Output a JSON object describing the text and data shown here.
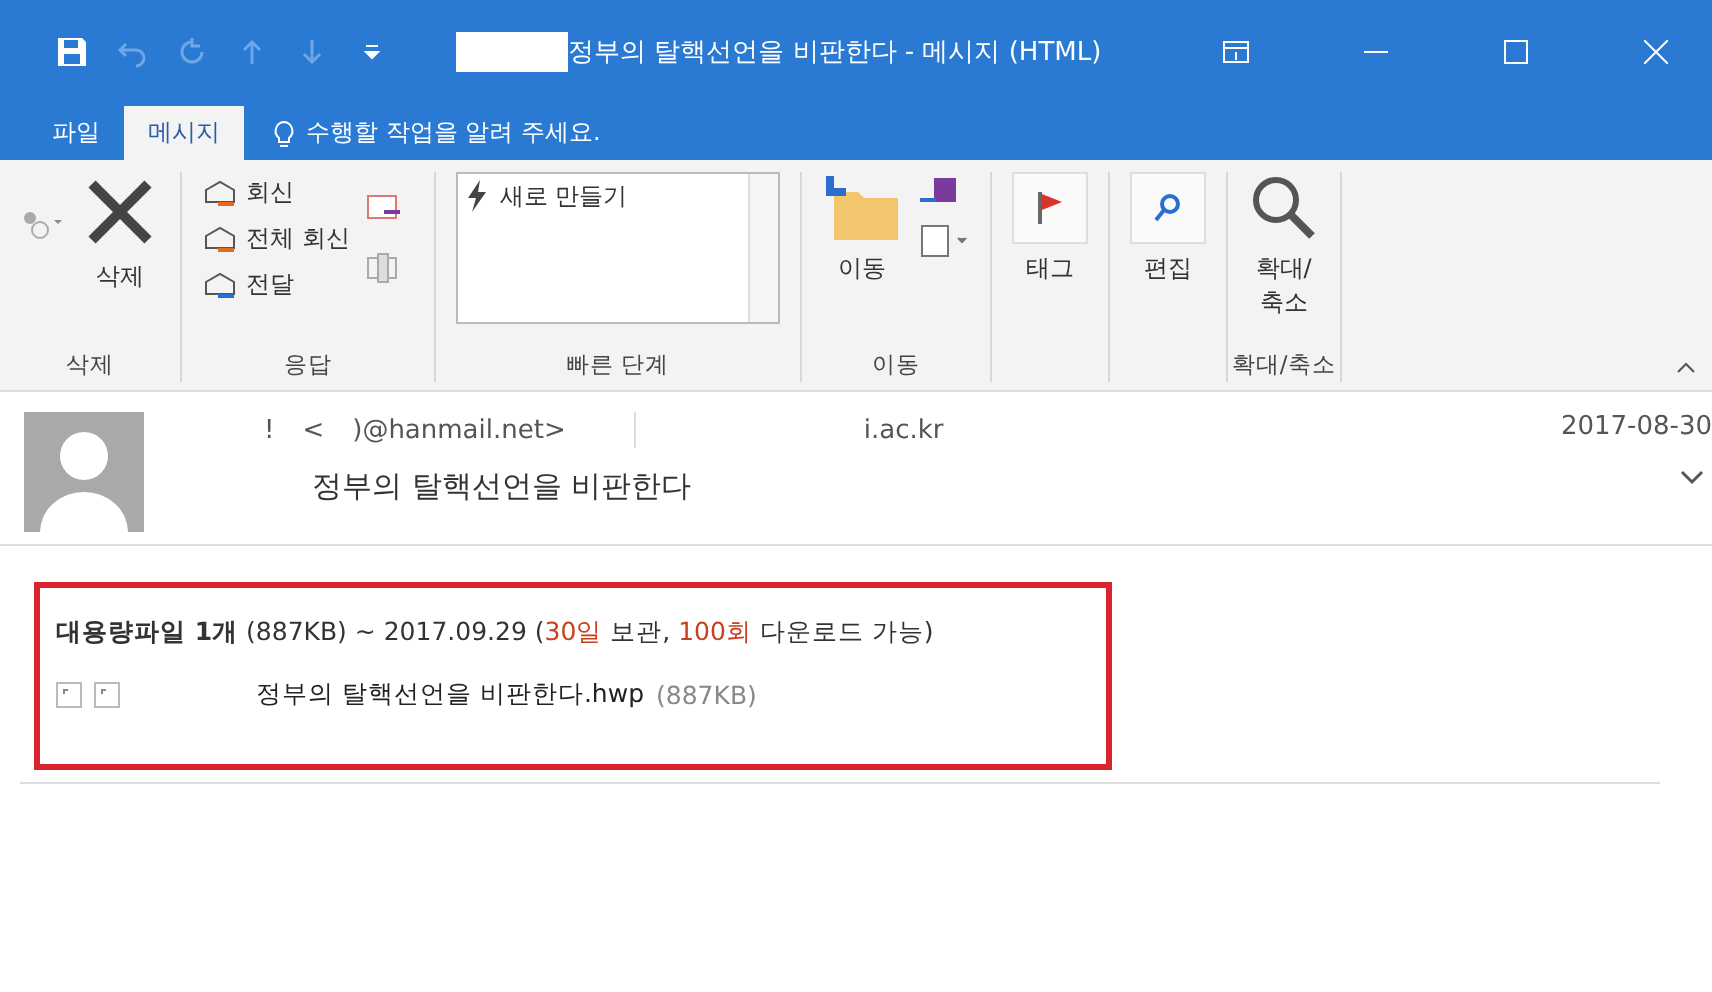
{
  "window": {
    "title": "정부의 탈핵선언을 비판한다 - 메시지 (HTML)"
  },
  "tabs": [
    {
      "label": "파일",
      "selected": false
    },
    {
      "label": "메시지",
      "selected": true
    }
  ],
  "tell_me": {
    "placeholder": "수행할 작업을 알려 주세요."
  },
  "ribbon": {
    "groups": [
      {
        "label": "삭제",
        "buttons": [
          {
            "kind": "ignore"
          },
          {
            "kind": "delete",
            "label": "삭제"
          }
        ]
      },
      {
        "label": "응답",
        "buttons": [
          {
            "kind": "reply",
            "label": "회신"
          },
          {
            "kind": "reply_all",
            "label": "전체 회신"
          },
          {
            "kind": "forward",
            "label": "전달"
          }
        ]
      },
      {
        "label": "빠른 단계",
        "buttons": [
          {
            "kind": "quick",
            "label": "새로 만들기"
          }
        ]
      },
      {
        "label": "이동",
        "buttons": [
          {
            "kind": "move",
            "label": "이동"
          }
        ]
      },
      {
        "buttons": [
          {
            "kind": "tag",
            "label": "태그"
          }
        ]
      },
      {
        "buttons": [
          {
            "kind": "edit",
            "label": "편집"
          }
        ]
      },
      {
        "label": "확대/축소",
        "buttons": [
          {
            "kind": "zoom",
            "label": "확대/\n축소"
          }
        ]
      }
    ]
  },
  "message": {
    "sender_parts": [
      "!",
      "<",
      ")@hanmail.net>"
    ],
    "recipient": "i.ac.kr",
    "date": "2017-08-30",
    "subject": "정부의 탈핵선언을 비판한다"
  },
  "notice": {
    "parts": [
      {
        "text": "대용량파일 1개",
        "kind": "bold"
      },
      {
        "text": " (887KB) ~ 2017.09.29 (",
        "kind": "plain"
      },
      {
        "text": "30일",
        "kind": "red"
      },
      {
        "text": " 보관, ",
        "kind": "plain"
      },
      {
        "text": "100회",
        "kind": "red"
      },
      {
        "text": " 다운로드 가능)",
        "kind": "plain"
      }
    ],
    "attachment": {
      "name": "정부의 탈핵선언을 비판한다.hwp",
      "size": "(887KB)"
    }
  }
}
